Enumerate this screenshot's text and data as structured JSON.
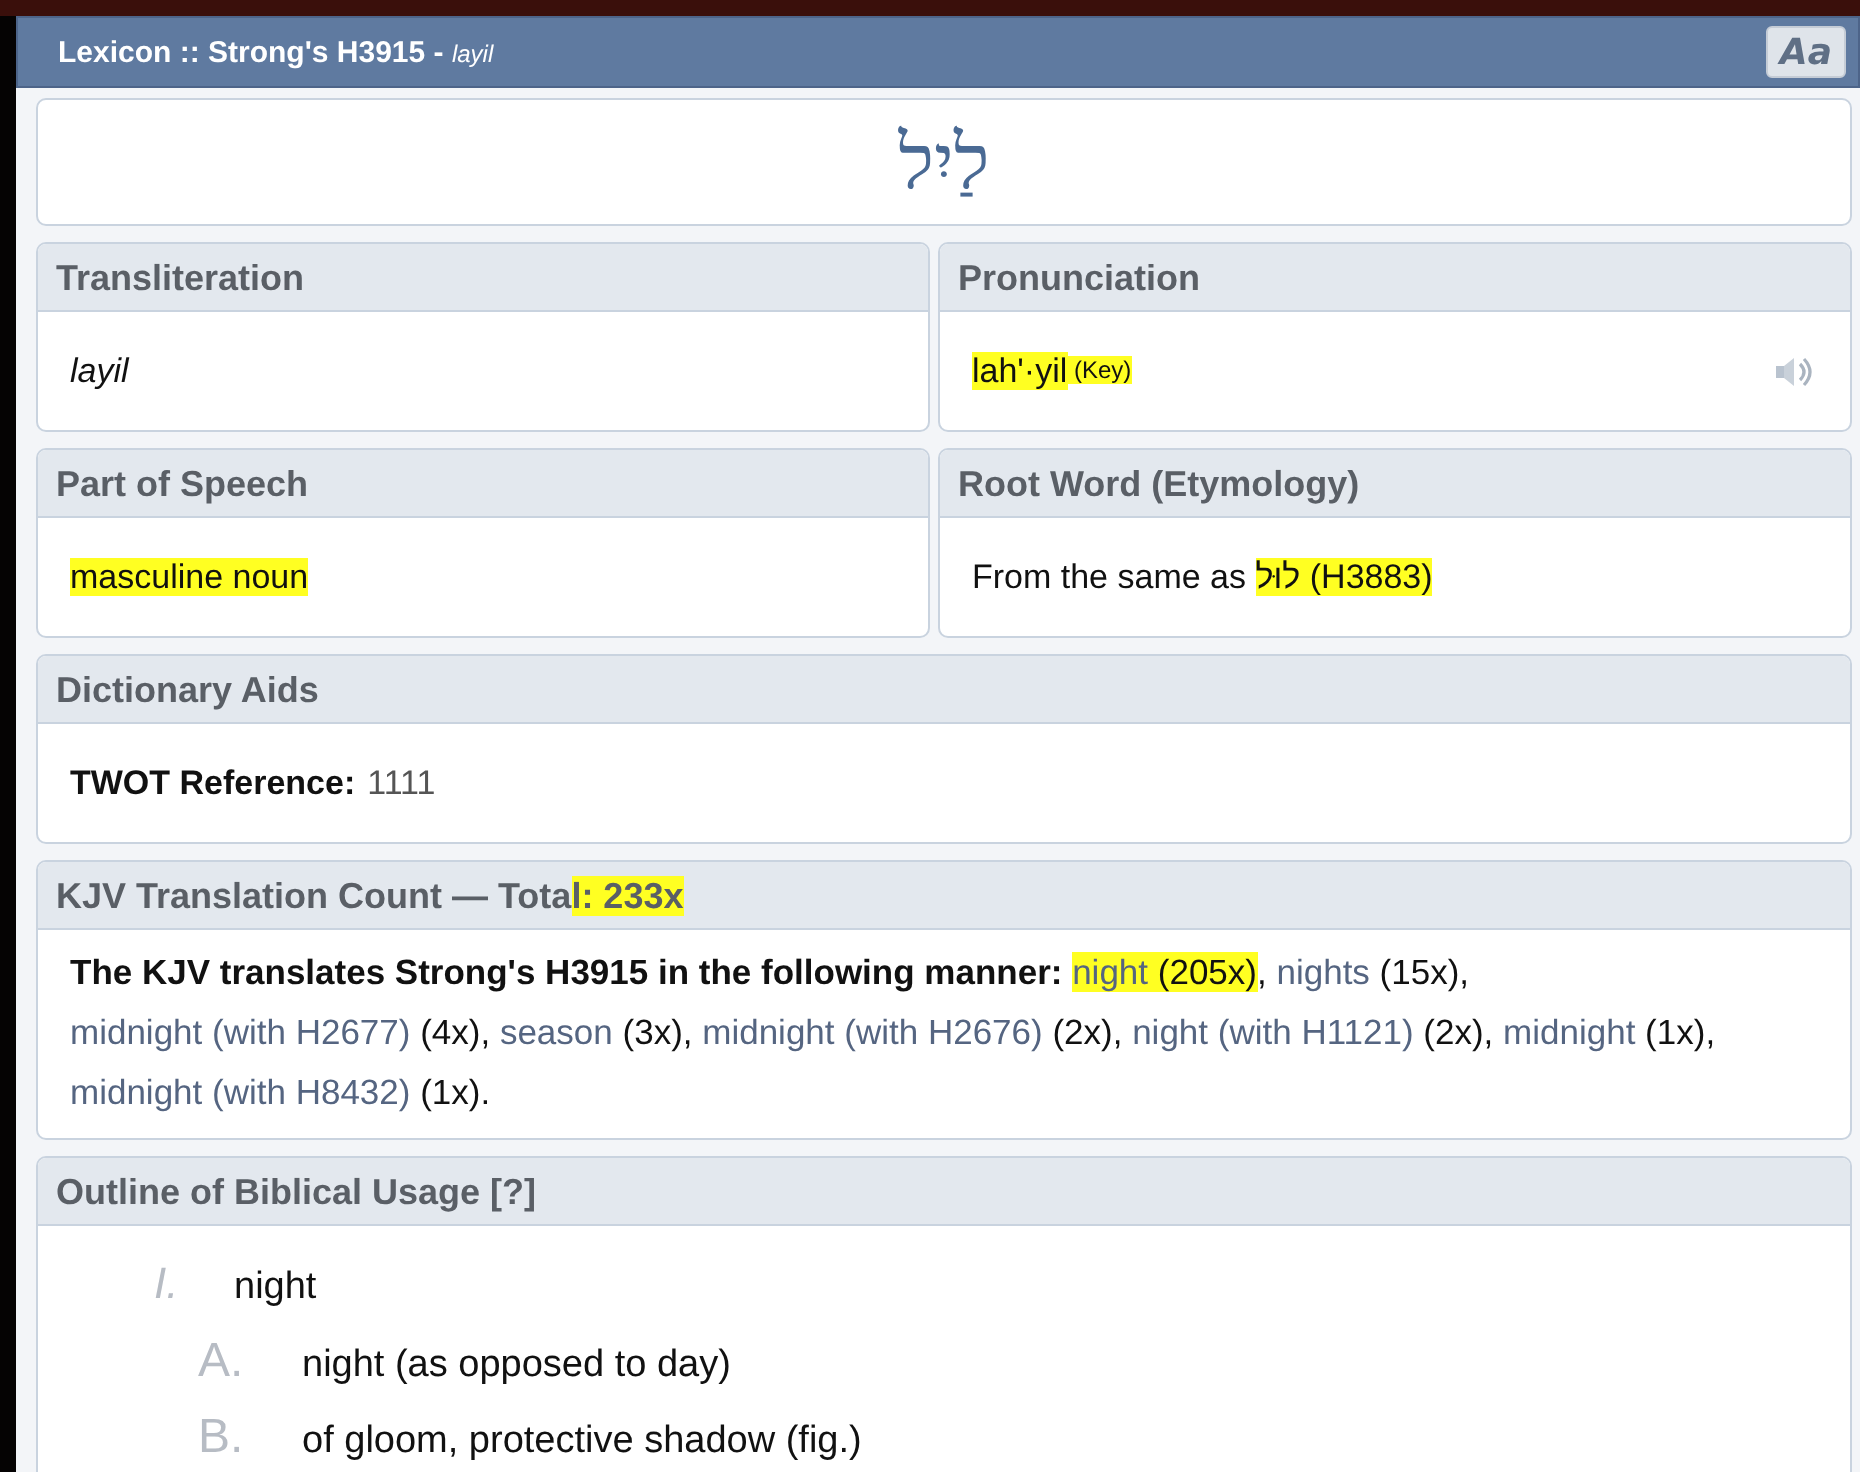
{
  "window": {
    "title": "Lexicon :: Strong's H3915 - ",
    "title_word": "layil",
    "font_button": "Aa"
  },
  "headword": "לַיִל",
  "fields": [
    {
      "label": "Transliteration",
      "segments": [
        {
          "text": "layil",
          "kind": "italic",
          "highlighted": false
        }
      ]
    },
    {
      "label": "Pronunciation",
      "audio": true,
      "segments": [
        {
          "text": "lah'·yil",
          "kind": "plain",
          "highlighted": true
        },
        {
          "text": " (Key)",
          "kind": "small",
          "highlighted": true
        }
      ]
    },
    {
      "label": "Part of Speech",
      "segments": [
        {
          "text": "masculine noun",
          "kind": "plain",
          "highlighted": true
        }
      ]
    },
    {
      "label": "Root Word (Etymology)",
      "segments": [
        {
          "text": "From the same as ",
          "kind": "plain",
          "highlighted": false
        },
        {
          "text": "לוּל (H3883)",
          "kind": "plain",
          "highlighted": true
        }
      ]
    }
  ],
  "dictionary_aids": {
    "label": "Dictionary Aids",
    "term": "TWOT Reference:",
    "value": "1111"
  },
  "kjv": {
    "label": [
      {
        "text": "KJV Translation Count — Tota",
        "highlighted": false
      },
      {
        "text": "l: 233x",
        "highlighted": true
      }
    ],
    "segments": [
      {
        "text": "The KJV translates Strong's H3915 in the following manner: ",
        "kind": "bold",
        "highlighted": false
      },
      {
        "text": "night",
        "kind": "link",
        "highlighted": true
      },
      {
        "text": " (205x)",
        "kind": "plain",
        "highlighted": true
      },
      {
        "text": ", ",
        "kind": "plain",
        "highlighted": false
      },
      {
        "text": "nights",
        "kind": "link",
        "highlighted": false
      },
      {
        "text": " (15x), ",
        "kind": "plain",
        "highlighted": false
      },
      {
        "text": "midnight (with H2677)",
        "kind": "link",
        "highlighted": false
      },
      {
        "text": " (4x), ",
        "kind": "plain",
        "highlighted": false
      },
      {
        "text": "season",
        "kind": "link",
        "highlighted": false
      },
      {
        "text": " (3x), ",
        "kind": "plain",
        "highlighted": false
      },
      {
        "text": "midnight (with H2676)",
        "kind": "link",
        "highlighted": false
      },
      {
        "text": " (2x), ",
        "kind": "plain",
        "highlighted": false
      },
      {
        "text": "night (with H1121)",
        "kind": "link",
        "highlighted": false
      },
      {
        "text": " (2x), ",
        "kind": "plain",
        "highlighted": false
      },
      {
        "text": "midnight",
        "kind": "link",
        "highlighted": false
      },
      {
        "text": " (1x), ",
        "kind": "plain",
        "highlighted": false
      },
      {
        "text": "midnight (with H8432)",
        "kind": "link",
        "highlighted": false
      },
      {
        "text": " (1x).",
        "kind": "plain",
        "highlighted": false
      }
    ]
  },
  "outline": {
    "label": "Outline of Biblical Usage [?]",
    "items": [
      {
        "marker": "I.",
        "text": "night",
        "children": [
          {
            "marker": "A.",
            "text": "night (as opposed to day)"
          },
          {
            "marker": "B.",
            "text": "of gloom, protective shadow (fig.)"
          }
        ]
      }
    ]
  }
}
